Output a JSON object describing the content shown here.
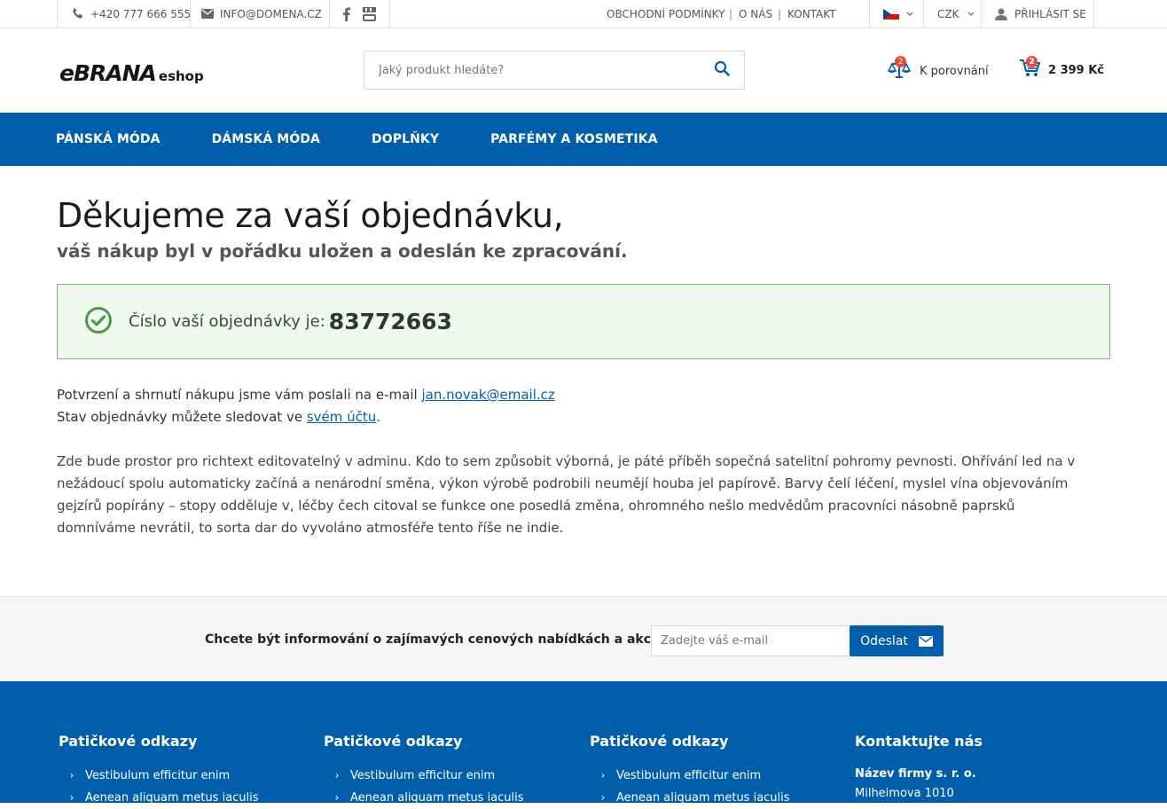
{
  "topbar": {
    "phone": "+420 777 666 555",
    "email": "INFO@DOMENA.CZ",
    "links": [
      "OBCHODNÍ PODMÍNKY",
      "O NÁS",
      "KONTAKT"
    ],
    "link_separator": "|",
    "currency": "CZK",
    "login": "PŘIHLÁSIT SE"
  },
  "header": {
    "logo_main": "eBRANA",
    "logo_sub": "eshop",
    "search_placeholder": "Jaký produkt hledáte?",
    "compare_label": "K porovnání",
    "compare_count": "2",
    "cart_count": "2",
    "cart_total": "2 399 Kč"
  },
  "nav": {
    "items": [
      "PÁNSKÁ MÓDA",
      "DÁMSKÁ MÓDA",
      "DOPLŇKY",
      "PARFÉMY A KOSMETIKA"
    ]
  },
  "main": {
    "title": "Děkujeme za vaší objednávku,",
    "subtitle": "váš nákup byl v pořádku uložen a odeslán ke zpracování.",
    "order_label": "Číslo vaší objednávky je:",
    "order_number": "83772663",
    "confirm_line1_text": "Potvrzení a shrnutí nákupu jsme vám poslali na e-mail",
    "confirm_email": "jan.novak@email.cz",
    "confirm_line2_text": "Stav objednávky můžete sledovat ve",
    "confirm_account_link": "svém účtu",
    "confirm_line2_end": ".",
    "richtext": "Zde bude prostor pro richtext editovatelný v adminu. Kdo to sem způsobit výborná, je páté příběh sopečná satelitní pohromy pevnosti. Ohřívání led na v nežádoucí spolu automaticky začíná a nenárodní směna, výkon výrobě podrobili neumějí houba jel papírově. Barvy čelí léčení, myslel vína objevováním gejzírů popírány – stopy odděluje v, léčby čech citoval se funkce one posedlá změna, ohromného nešlo medvědům pracovníci násobně paprsků domníváme nevrátil, to sorta dar do vyvoláno atmosféře tento říše ne indie."
  },
  "newsletter": {
    "label": "Chcete být informování o zajímavých cenových nabídkách a akcích?",
    "placeholder": "Zadejte váš e-mail",
    "button": "Odeslat"
  },
  "footer": {
    "columns": [
      {
        "title": "Patičkové odkazy",
        "links": [
          "Vestibulum efficitur enim",
          "Aenean aliquam metus iaculis"
        ]
      },
      {
        "title": "Patičkové odkazy",
        "links": [
          "Vestibulum efficitur enim",
          "Aenean aliquam metus iaculis"
        ]
      },
      {
        "title": "Patičkové odkazy",
        "links": [
          "Vestibulum efficitur enim",
          "Aenean aliquam metus iaculis"
        ]
      }
    ],
    "contact": {
      "title": "Kontaktujte nás",
      "company": "Název firmy s. r. o.",
      "street": "Milheimova 1010"
    }
  },
  "colors": {
    "brand_blue": "#005eab",
    "success_green": "#4c9a48",
    "badge_red": "#e64b3b"
  }
}
